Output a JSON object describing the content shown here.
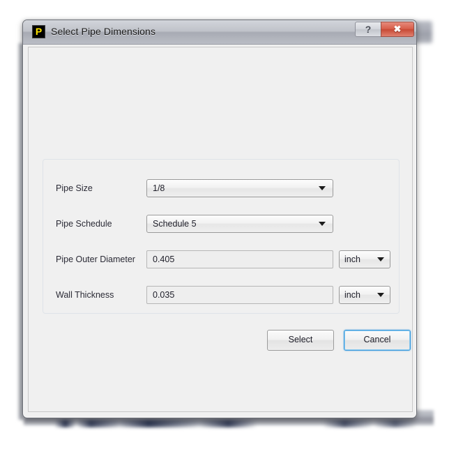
{
  "window": {
    "icon_letter": "P",
    "title": "Select Pipe Dimensions",
    "help_label": "?",
    "close_label": "✖"
  },
  "form": {
    "rows": [
      {
        "label": "Pipe Size",
        "control": "combobox",
        "value": "1/8",
        "arrow": "chevron-down-icon"
      },
      {
        "label": "Pipe Schedule",
        "control": "combobox",
        "value": "Schedule 5",
        "arrow": "chevron-down-icon"
      },
      {
        "label": "Pipe Outer Diameter",
        "control": "textbox",
        "value": "0.405",
        "unit": "inch"
      },
      {
        "label": "Wall Thickness",
        "control": "textbox",
        "value": "0.035",
        "unit": "inch"
      }
    ]
  },
  "buttons": {
    "select_label": "Select",
    "cancel_label": "Cancel"
  },
  "colors": {
    "close_button": "#d9604c",
    "focus_ring": "#3c9bdd",
    "icon_yellow": "#ffe400",
    "dialog_bg": "#f0f0f0"
  }
}
